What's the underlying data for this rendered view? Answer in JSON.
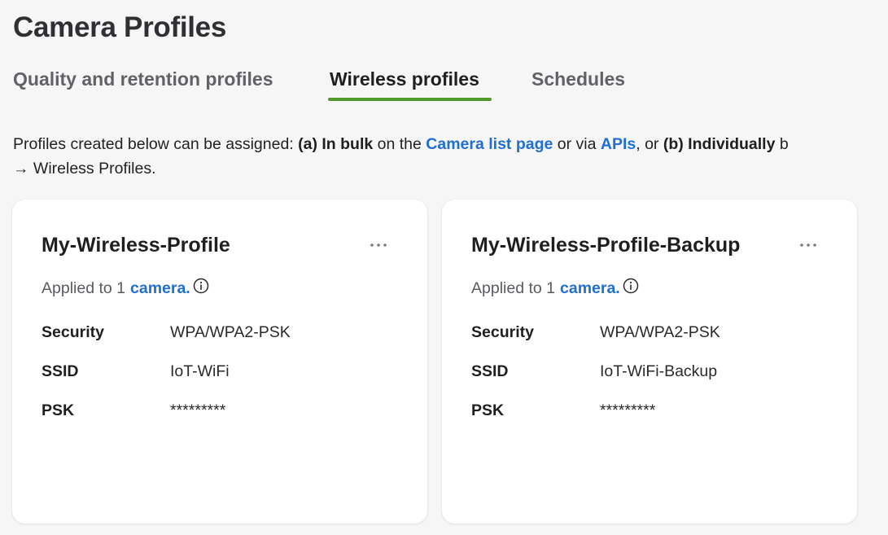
{
  "page": {
    "title": "Camera Profiles"
  },
  "tabs": [
    {
      "label": "Quality and retention profiles",
      "active": false
    },
    {
      "label": "Wireless profiles",
      "active": true
    },
    {
      "label": "Schedules",
      "active": false
    }
  ],
  "intro": {
    "part1": "Profiles created below can be assigned: ",
    "bulk_label": "(a) In bulk",
    "part2": " on the ",
    "camera_list_link": "Camera list page",
    "part3": " or via ",
    "apis_link": "APIs",
    "part4": ", or ",
    "individually_label": "(b) Individually",
    "part5": " b",
    "line2": "→ Wireless Profiles."
  },
  "colors": {
    "accent_tab": "#4f9a2b",
    "link": "#1f6fd1"
  },
  "cards": [
    {
      "title": "My-Wireless-Profile",
      "applied_prefix": "Applied to 1",
      "applied_link": "camera.",
      "rows": [
        {
          "key": "Security",
          "value": "WPA/WPA2-PSK"
        },
        {
          "key": "SSID",
          "value": "IoT-WiFi"
        },
        {
          "key": "PSK",
          "value": "*********"
        }
      ]
    },
    {
      "title": "My-Wireless-Profile-Backup",
      "applied_prefix": "Applied to 1",
      "applied_link": "camera.",
      "rows": [
        {
          "key": "Security",
          "value": "WPA/WPA2-PSK"
        },
        {
          "key": "SSID",
          "value": "IoT-WiFi-Backup"
        },
        {
          "key": "PSK",
          "value": "*********"
        }
      ]
    }
  ],
  "icons": {
    "more": "more-horizontal-icon",
    "info": "info-icon"
  }
}
